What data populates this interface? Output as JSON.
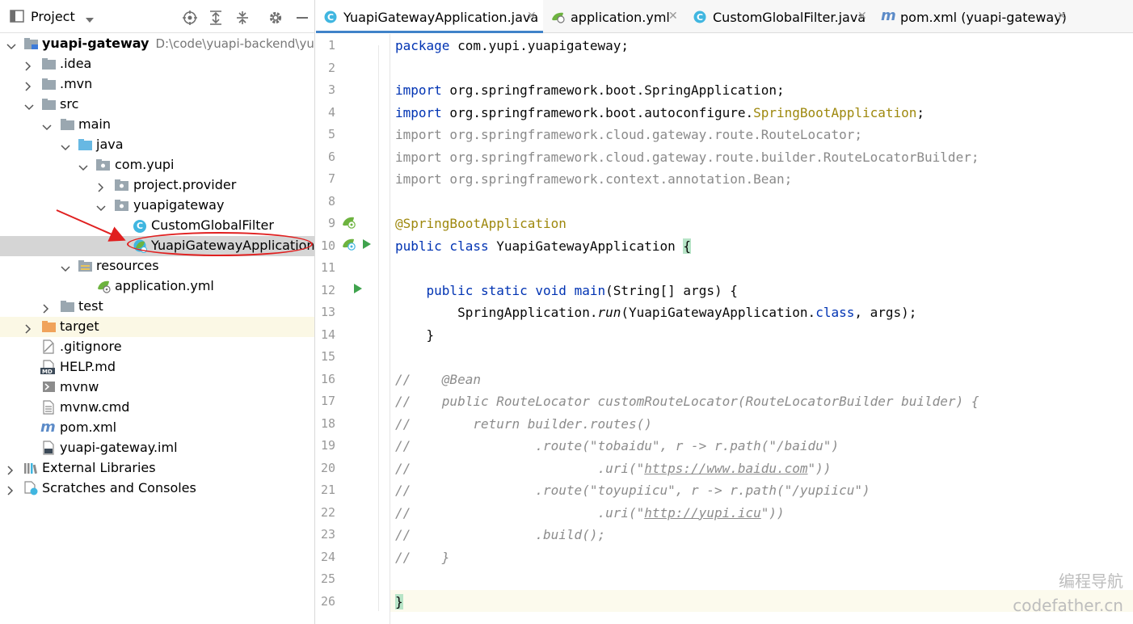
{
  "panel": {
    "title": "Project"
  },
  "tree": [
    {
      "label": "yuapi-gateway",
      "path": "D:\\code\\yuapi-backend\\yuapi"
    },
    {
      "label": ".idea"
    },
    {
      "label": ".mvn"
    },
    {
      "label": "src"
    },
    {
      "label": "main"
    },
    {
      "label": "java"
    },
    {
      "label": "com.yupi"
    },
    {
      "label": "project.provider"
    },
    {
      "label": "yuapigateway"
    },
    {
      "label": "CustomGlobalFilter"
    },
    {
      "label": "YuapiGatewayApplication"
    },
    {
      "label": "resources"
    },
    {
      "label": "application.yml"
    },
    {
      "label": "test"
    },
    {
      "label": "target"
    },
    {
      "label": ".gitignore"
    },
    {
      "label": "HELP.md"
    },
    {
      "label": "mvnw"
    },
    {
      "label": "mvnw.cmd"
    },
    {
      "label": "pom.xml"
    },
    {
      "label": "yuapi-gateway.iml"
    },
    {
      "label": "External Libraries"
    },
    {
      "label": "Scratches and Consoles"
    }
  ],
  "tabs": [
    {
      "label": "YuapiGatewayApplication.java",
      "active": true
    },
    {
      "label": "application.yml"
    },
    {
      "label": "CustomGlobalFilter.java"
    },
    {
      "label": "pom.xml (yuapi-gateway)"
    }
  ],
  "line_numbers": [
    "1",
    "2",
    "3",
    "4",
    "5",
    "6",
    "7",
    "8",
    "9",
    "10",
    "11",
    "12",
    "13",
    "14",
    "15",
    "16",
    "17",
    "18",
    "19",
    "20",
    "21",
    "22",
    "23",
    "24",
    "25",
    "26"
  ],
  "code": [
    [
      [
        "kw",
        "package"
      ],
      [
        "plain",
        " com.yupi.yuapigateway;"
      ]
    ],
    [],
    [
      [
        "kw",
        "import"
      ],
      [
        "plain",
        " org.springframework.boot.SpringApplication;"
      ]
    ],
    [
      [
        "kw",
        "import"
      ],
      [
        "plain",
        " org.springframework.boot.autoconfigure."
      ],
      [
        "ann",
        "SpringBootApplication"
      ],
      [
        "plain",
        ";"
      ]
    ],
    [
      [
        "dim",
        "import org.springframework.cloud.gateway.route.RouteLocator;"
      ]
    ],
    [
      [
        "dim",
        "import org.springframework.cloud.gateway.route.builder.RouteLocatorBuilder;"
      ]
    ],
    [
      [
        "dim",
        "import org.springframework.context.annotation.Bean;"
      ]
    ],
    [],
    [
      [
        "ann",
        "@SpringBootApplication"
      ]
    ],
    [
      [
        "kw",
        "public class"
      ],
      [
        "plain",
        " YuapiGatewayApplication "
      ],
      [
        "brace",
        "{"
      ]
    ],
    [],
    [
      [
        "plain",
        "    "
      ],
      [
        "kw",
        "public static void"
      ],
      [
        "plain",
        " "
      ],
      [
        "kw",
        "main"
      ],
      [
        "plain",
        "(String[] args) {"
      ]
    ],
    [
      [
        "plain",
        "        SpringApplication."
      ],
      [
        "italic",
        "run"
      ],
      [
        "plain",
        "(YuapiGatewayApplication."
      ],
      [
        "kw",
        "class"
      ],
      [
        "plain",
        ", args);"
      ]
    ],
    [
      [
        "plain",
        "    }"
      ]
    ],
    [],
    [
      [
        "cmt",
        "//    @Bean"
      ]
    ],
    [
      [
        "cmt",
        "//    public RouteLocator customRouteLocator(RouteLocatorBuilder builder) {"
      ]
    ],
    [
      [
        "cmt",
        "//        return builder.routes()"
      ]
    ],
    [
      [
        "cmt",
        "//                .route(\"tobaidu\", r -> r.path(\"/baidu\")"
      ]
    ],
    [
      [
        "cmt",
        "//                        .uri(\""
      ],
      [
        "cmtlink",
        "https://www.baidu.com"
      ],
      [
        "cmt",
        "\"))"
      ]
    ],
    [
      [
        "cmt",
        "//                .route(\"toyupiicu\", r -> r.path(\"/yupiicu\")"
      ]
    ],
    [
      [
        "cmt",
        "//                        .uri(\""
      ],
      [
        "cmtlink",
        "http://yupi.icu"
      ],
      [
        "cmt",
        "\"))"
      ]
    ],
    [
      [
        "cmt",
        "//                .build();"
      ]
    ],
    [
      [
        "cmt",
        "//    }"
      ]
    ],
    [],
    [
      [
        "brace",
        "}"
      ]
    ]
  ],
  "watermark": {
    "line1": "编程导航",
    "line2": "codefather.cn"
  }
}
